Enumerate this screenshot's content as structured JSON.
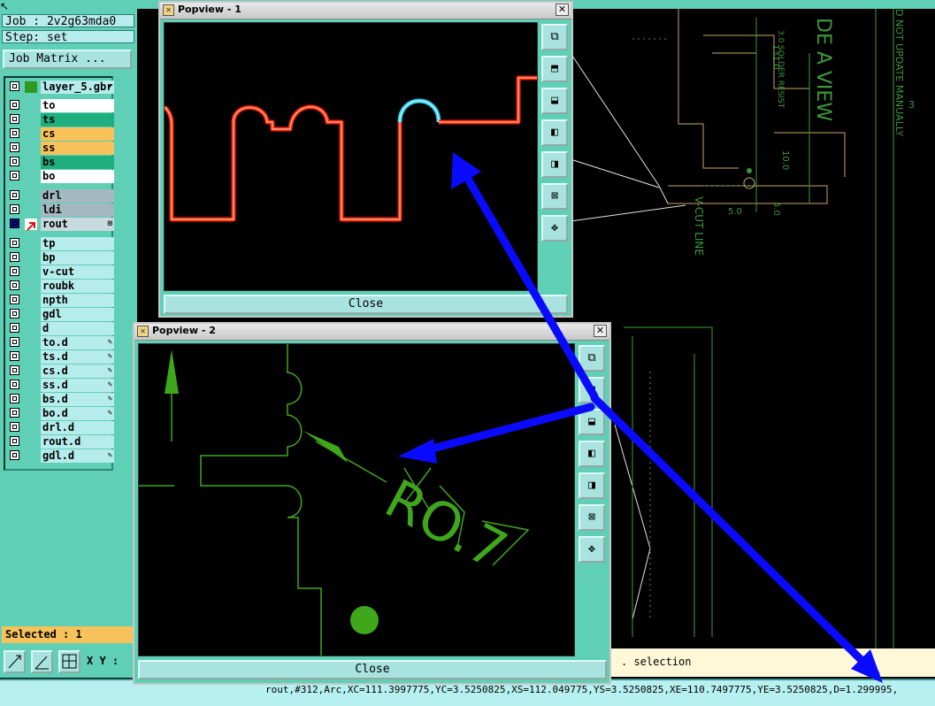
{
  "job": {
    "label": "Job : 2v2g63mda0",
    "step": "Step: set",
    "matrix_button": "Job Matrix ..."
  },
  "layers": [
    {
      "name": "layer_5.gbr",
      "bg": "#b7ecec",
      "mark": "▾"
    },
    {
      "name": "to",
      "bg": "#ffffff",
      "mark": ""
    },
    {
      "name": "ts",
      "bg": "#1fae7e",
      "mark": ""
    },
    {
      "name": "cs",
      "bg": "#f7c25a",
      "mark": ""
    },
    {
      "name": "ss",
      "bg": "#f7c25a",
      "mark": ""
    },
    {
      "name": "bs",
      "bg": "#1fae7e",
      "mark": ""
    },
    {
      "name": "bo",
      "bg": "#ffffff",
      "mark": ""
    },
    {
      "name": "drl",
      "bg": "#a3b8c0",
      "mark": ""
    },
    {
      "name": "ldi",
      "bg": "#a3b8c0",
      "mark": ""
    },
    {
      "name": "rout",
      "bg": "#c8dadd",
      "mark": "⊞"
    },
    {
      "name": "tp",
      "bg": "#b7ecec",
      "mark": ""
    },
    {
      "name": "bp",
      "bg": "#b7ecec",
      "mark": ""
    },
    {
      "name": "v-cut",
      "bg": "#b7ecec",
      "mark": ""
    },
    {
      "name": "roubk",
      "bg": "#b7ecec",
      "mark": ""
    },
    {
      "name": "npth",
      "bg": "#b7ecec",
      "mark": ""
    },
    {
      "name": "gdl",
      "bg": "#b7ecec",
      "mark": ""
    },
    {
      "name": "d",
      "bg": "#b7ecec",
      "mark": ""
    },
    {
      "name": "to.d",
      "bg": "#b7ecec",
      "mark": "✎"
    },
    {
      "name": "ts.d",
      "bg": "#b7ecec",
      "mark": "✎"
    },
    {
      "name": "cs.d",
      "bg": "#b7ecec",
      "mark": "✎"
    },
    {
      "name": "ss.d",
      "bg": "#b7ecec",
      "mark": "✎"
    },
    {
      "name": "bs.d",
      "bg": "#b7ecec",
      "mark": "✎"
    },
    {
      "name": "bo.d",
      "bg": "#b7ecec",
      "mark": "✎"
    },
    {
      "name": "drl.d",
      "bg": "#b7ecec",
      "mark": ""
    },
    {
      "name": "rout.d",
      "bg": "#b7ecec",
      "mark": ""
    },
    {
      "name": "gdl.d",
      "bg": "#b7ecec",
      "mark": "✎"
    }
  ],
  "selected_text": "Selected : 1",
  "xy_label": "X Y :",
  "message": ". selection",
  "status_line": "rout,#312,Arc,XC=111.3997775,YC=3.5250825,XS=112.049775,YS=3.5250825,XE=110.7497775,YE=3.5250825,D=1.299995,",
  "popview1": {
    "title": "Popview - 1",
    "close_label": "Close"
  },
  "popview2": {
    "title": "Popview - 2",
    "close_label": "Close"
  },
  "tool_icons": [
    "zoom-home-icon",
    "zoom-up-icon",
    "zoom-down-icon",
    "pan-left-icon",
    "pan-right-icon",
    "zoom-fit-icon",
    "pan-center-icon"
  ],
  "drawing_text": {
    "a_view": "DE A VIEW",
    "do_not_update": "D NOT UPDATE MANUALLY",
    "solder_resist": "3.0 SOLDER RESIST",
    "vcut_line": "V-CUT LINE",
    "ro": "RO.7",
    "dim_131": "131.0",
    "dim_100": "10.0",
    "dim_50a": "5.0",
    "dim_50b": "5.0",
    "dim_3": "3"
  },
  "colors": {
    "panel": "#5fcfb6",
    "arrow": "#0a0aff",
    "trace": "#ff2200",
    "highlight": "#2ec8e8",
    "green_line": "#3fa71c"
  }
}
